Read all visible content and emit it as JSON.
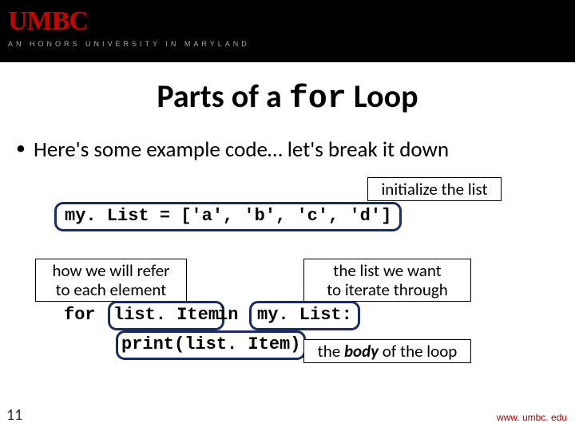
{
  "header": {
    "logo": "UMBC",
    "tagline": "AN HONORS UNIVERSITY IN MARYLAND"
  },
  "title": {
    "pre": "Parts of a ",
    "mono": "for",
    "post": " Loop"
  },
  "bullet": "Here's some example code… let's break it down",
  "labels": {
    "initialize": "initialize the list",
    "refer": "how we will refer\nto each element",
    "iterate": "the list we want\nto iterate through",
    "body_pre": "the ",
    "body_bold": "body",
    "body_post": " of the loop"
  },
  "code": {
    "mylist_assign": "my. List = ['a', 'b', 'c', 'd']",
    "for_kw": "for",
    "list_item": "list. Item",
    "in_kw": "in",
    "mylist_ref": "my. List:",
    "print_line": "print(list. Item)"
  },
  "footer": {
    "slide_number": "11",
    "url": "www. umbc. edu"
  }
}
